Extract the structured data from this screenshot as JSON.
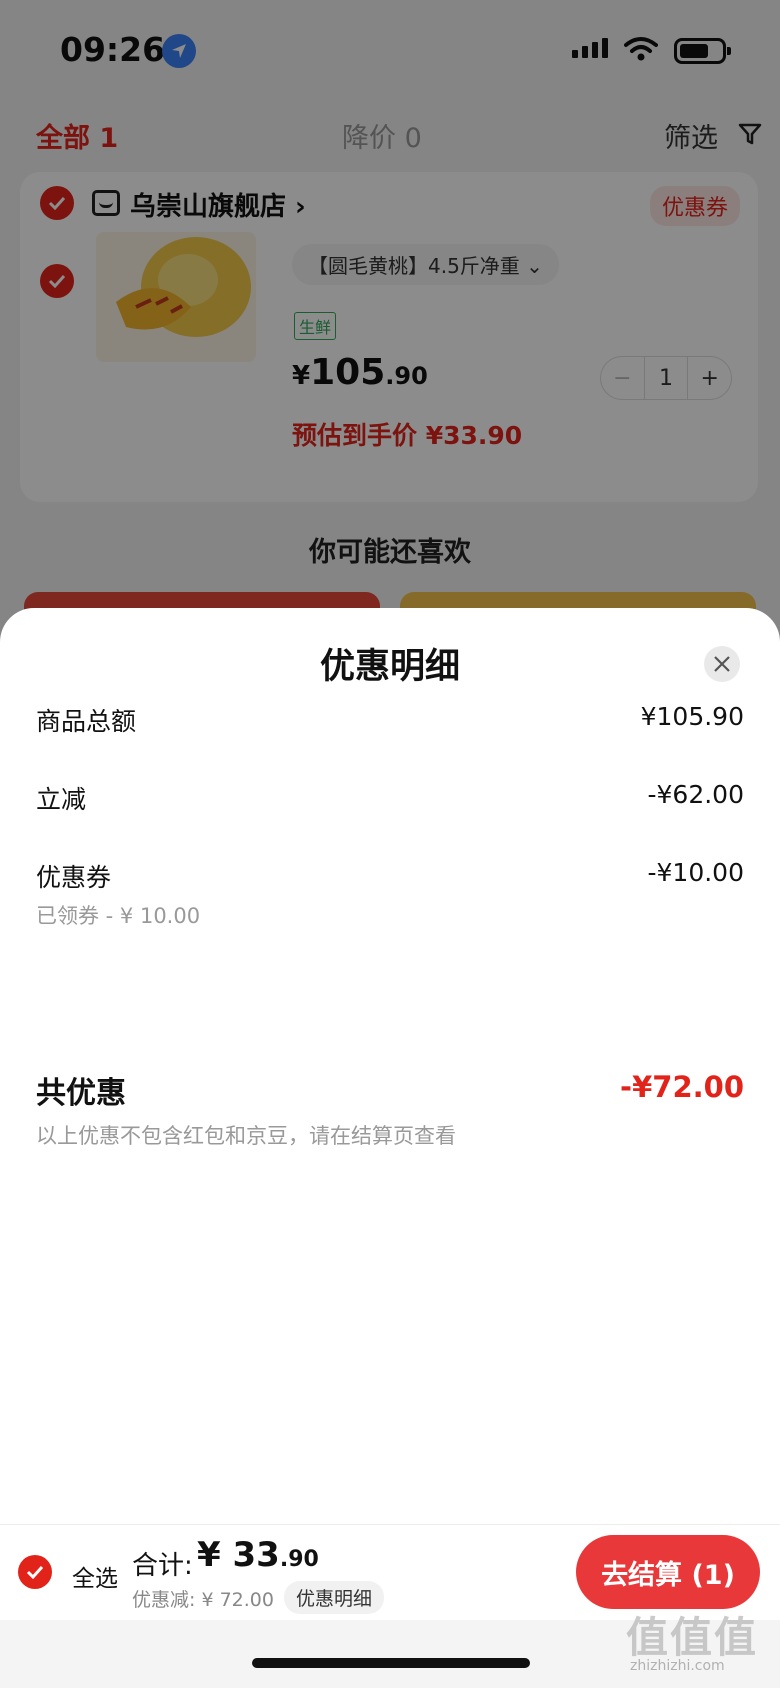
{
  "status_bar": {
    "time": "09:26"
  },
  "tabs": {
    "all": "全部 1",
    "price_drop": "降价 0",
    "filter": "筛选"
  },
  "store": {
    "name": "乌崇山旗舰店 ›",
    "coupon_tag": "优惠券",
    "item": {
      "title": "【圆毛黄桃】4.5斤净重 ⌄",
      "fresh_tag": "生鲜",
      "price_currency": "¥",
      "price_int": "105",
      "price_dec": ".90",
      "quantity": "1",
      "minus": "−",
      "plus": "+",
      "estimated_price": "预估到手价 ¥33.90"
    }
  },
  "recommend": {
    "title": "你可能还喜欢"
  },
  "sheet": {
    "title": "优惠明细",
    "rows": [
      {
        "label": "商品总额",
        "value": "¥105.90"
      },
      {
        "label": "立减",
        "value": "-¥62.00"
      },
      {
        "label": "优惠券",
        "value": "-¥10.00",
        "sub": "已领券 - ¥ 10.00"
      }
    ],
    "total": {
      "label": "共优惠",
      "value": "-¥72.00",
      "note": "以上优惠不包含红包和京豆，请在结算页查看"
    }
  },
  "bottom_bar": {
    "select_all": "全选",
    "sum_label": "合计:",
    "sum_currency": "¥",
    "sum_int": "33",
    "sum_dec": ".90",
    "discount": "优惠减: ¥ 72.00",
    "detail_link": "优惠明细",
    "checkout": "去结算 (1)"
  },
  "watermark": {
    "text": "值值值",
    "url": "zhizhizhi.com"
  },
  "colors": {
    "accent": "#e2231a",
    "checkout": "#e8383a",
    "fresh": "#2eaa5a"
  }
}
